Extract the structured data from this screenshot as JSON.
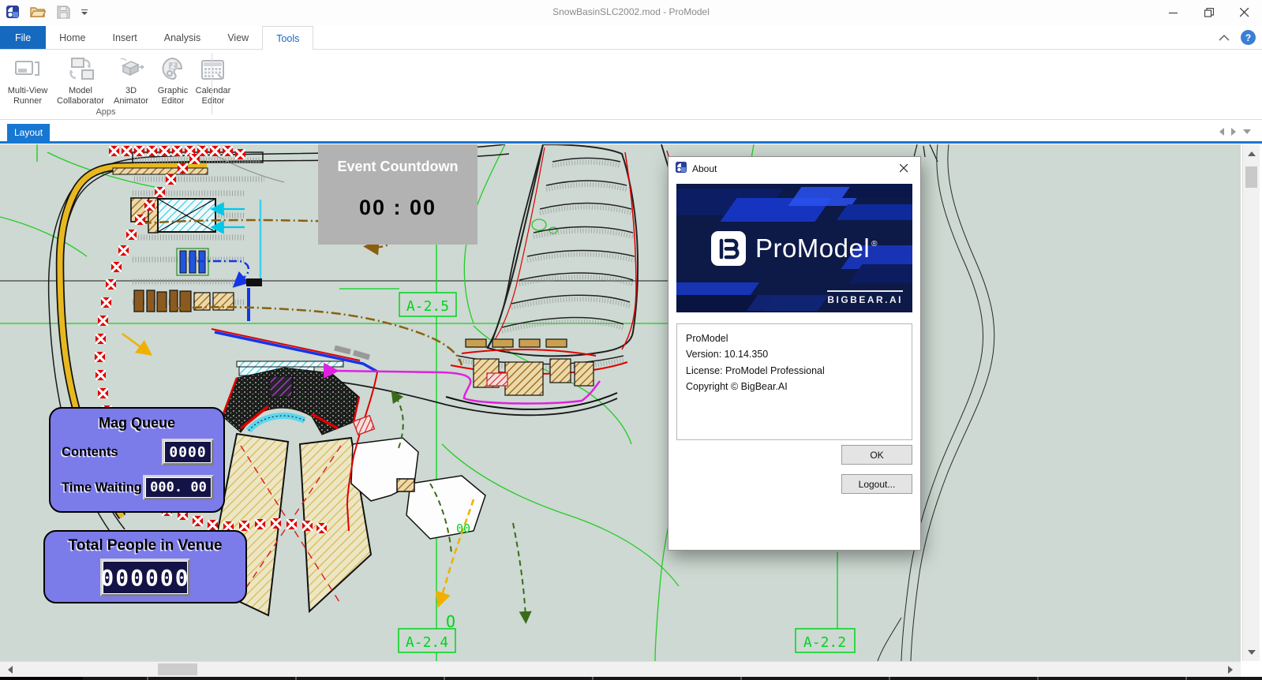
{
  "window": {
    "title": "SnowBasinSLC2002.mod - ProModel"
  },
  "ribbon": {
    "tabs": [
      "File",
      "Home",
      "Insert",
      "Analysis",
      "View",
      "Tools"
    ],
    "active_tab": "Tools",
    "help_glyph": "?",
    "group": {
      "label": "Apps",
      "buttons": [
        {
          "label1": "Multi-View",
          "label2": "Runner",
          "icon": "multi-view-icon"
        },
        {
          "label1": "Model",
          "label2": "Collaborator",
          "icon": "collaborate-icon"
        },
        {
          "label1": "3D",
          "label2": "Animator",
          "icon": "cube-3d-icon"
        },
        {
          "label1": "Graphic",
          "label2": "Editor",
          "icon": "palette-icon"
        },
        {
          "label1": "Calendar",
          "label2": "Editor",
          "icon": "calendar-icon"
        }
      ]
    }
  },
  "layout_bar": {
    "tab": "Layout"
  },
  "canvas": {
    "event_countdown": {
      "title": "Event Countdown",
      "time": "00 : 00"
    },
    "mag_queue": {
      "title": "Mag Queue",
      "contents_label": "Contents",
      "contents_value": "0000",
      "waiting_label": "Time Waiting",
      "waiting_value": "000. 00"
    },
    "total_people": {
      "title": "Total People in Venue",
      "value": "000000"
    },
    "labels": {
      "a25": "A-2.5",
      "a24": "A-2.4",
      "a22": "A-2.2",
      "oo": "00",
      "o": "O"
    }
  },
  "dialog": {
    "title": "About",
    "logo_text": "ProModel",
    "logo_reg": "®",
    "brand": "BIGBEAR.AI",
    "info_line1": "ProModel",
    "info_line2": "Version: 10.14.350",
    "info_line3": "License: ProModel Professional",
    "info_line4": "Copyright © BigBear.AI",
    "ok": "OK",
    "logout": "Logout..."
  },
  "colors": {
    "accent_blue": "#1569bf",
    "layout_tab_blue": "#1777d1",
    "canvas_bg": "#cdd9d2",
    "panel_purple": "#7b7bea",
    "led_navy": "#131347",
    "countdown_gray": "#b2b2b2",
    "map_green": "#00d41c",
    "banner_navy": "#0d1947",
    "barrier_red": "#e00000"
  }
}
